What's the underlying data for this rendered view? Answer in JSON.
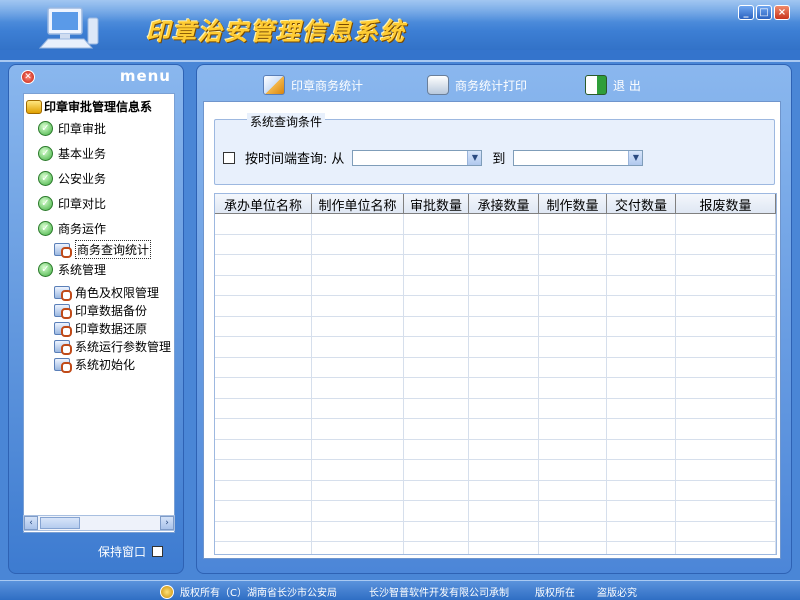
{
  "app": {
    "title": "印章治安管理信息系统"
  },
  "window_controls": [
    "_",
    "□",
    "×"
  ],
  "left_menu": {
    "label": "menu",
    "root": "印章审批管理信息系",
    "items": [
      {
        "label": "印章审批",
        "icon": "check-circle-icon"
      },
      {
        "label": "基本业务",
        "icon": "check-circle-icon"
      },
      {
        "label": "公安业务",
        "icon": "check-circle-icon"
      },
      {
        "label": "印章对比",
        "icon": "check-circle-icon"
      },
      {
        "label": "商务运作",
        "icon": "check-circle-icon"
      },
      {
        "label": "系统管理",
        "icon": "check-circle-icon"
      }
    ],
    "business_sub": [
      "商务查询统计"
    ],
    "system_sub": [
      "角色及权限管理",
      "印章数据备份",
      "印章数据还原",
      "系统运行参数管理",
      "系统初始化"
    ],
    "keep_window": "保持窗口"
  },
  "toolbar": {
    "stats": "印章商务统计",
    "print": "商务统计打印",
    "exit": "退 出"
  },
  "query": {
    "legend": "系统查询条件",
    "by_time": "按时间端查询:",
    "from": "从",
    "to": "到",
    "from_value": "",
    "to_value": ""
  },
  "grid": {
    "columns": [
      "承办单位名称",
      "制作单位名称",
      "审批数量",
      "承接数量",
      "制作数量",
      "交付数量",
      "报废数量"
    ],
    "rows": []
  },
  "footer": {
    "copyright": "版权所有（C）湖南省长沙市公安局",
    "developer": "长沙智普软件开发有限公司承制",
    "rights": "版权所在",
    "piracy": "盗版必究"
  },
  "colors": {
    "title": "#ffcc33",
    "panel": "#4a86d6",
    "content_bg": "#ffffff"
  }
}
